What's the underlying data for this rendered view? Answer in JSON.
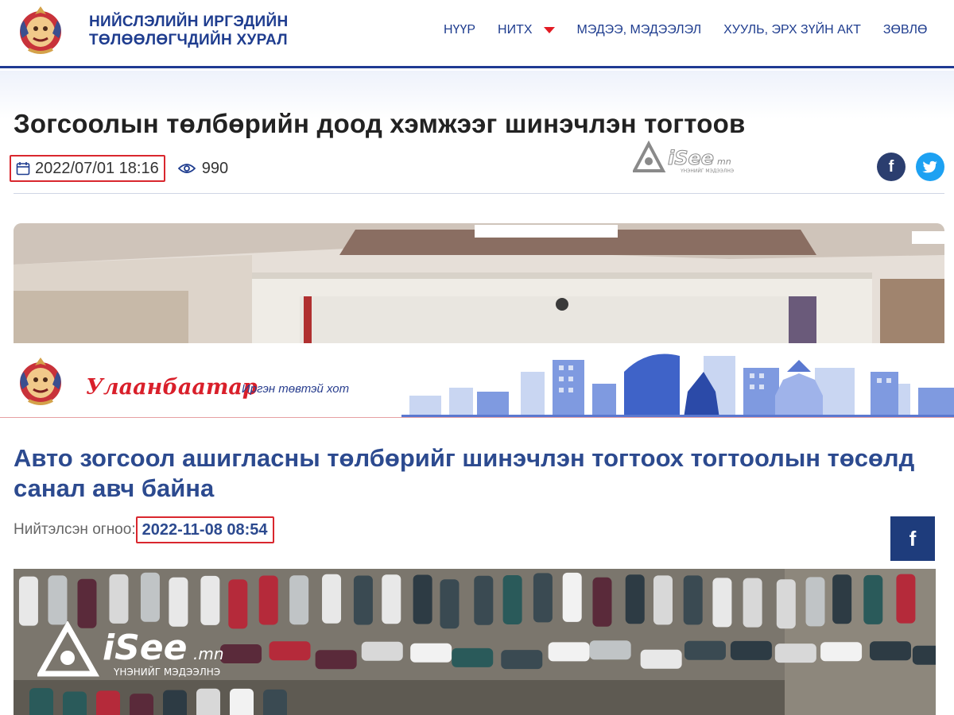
{
  "top_site": {
    "org_name_line1": "НИЙСЛЭЛИЙН ИРГЭДИЙН",
    "org_name_line2": "ТӨЛӨӨЛӨГЧДИЙН ХУРАЛ",
    "nav": [
      {
        "label": "НҮҮР"
      },
      {
        "label": "НИТХ"
      },
      {
        "label": "МЭДЭЭ, МЭДЭЭЛЭЛ"
      },
      {
        "label": "ХУУЛЬ, ЭРХ ЗҮЙН АКТ"
      },
      {
        "label": "ЗӨВЛӨ"
      }
    ],
    "article": {
      "title": "Зогсоолын төлбөрийн доод хэмжээг шинэчлэн тогтоов",
      "date": "2022/07/01 18:16",
      "views": "990"
    },
    "social": {
      "facebook": "f"
    },
    "accent_color": "#1f3d8f"
  },
  "bottom_site": {
    "logo_text": "Улаанбаатар",
    "slogan": "Иргэн төвтэй хот",
    "article": {
      "title": "Авто зогсоол ашигласны төлбөрийг шинэчлэн тогтоох тогтоолын төсөлд санал авч байна",
      "published_label": "Нийтэлсэн огноо:",
      "date": "2022-11-08 08:54"
    },
    "social": {
      "facebook": "f"
    },
    "accent_color": "#2c4a8f",
    "brand_red": "#d91f2a"
  },
  "watermark": {
    "brand": "iSee",
    "domain": ".mn",
    "tagline": "ҮНЭНИЙГ МЭДЭЭЛНЭ"
  },
  "highlight_color": "#d9272e",
  "icons": [
    "calendar-icon",
    "eye-icon",
    "facebook-icon",
    "twitter-icon",
    "caret-down-icon",
    "city-emblem-icon",
    "isee-logo-icon"
  ]
}
